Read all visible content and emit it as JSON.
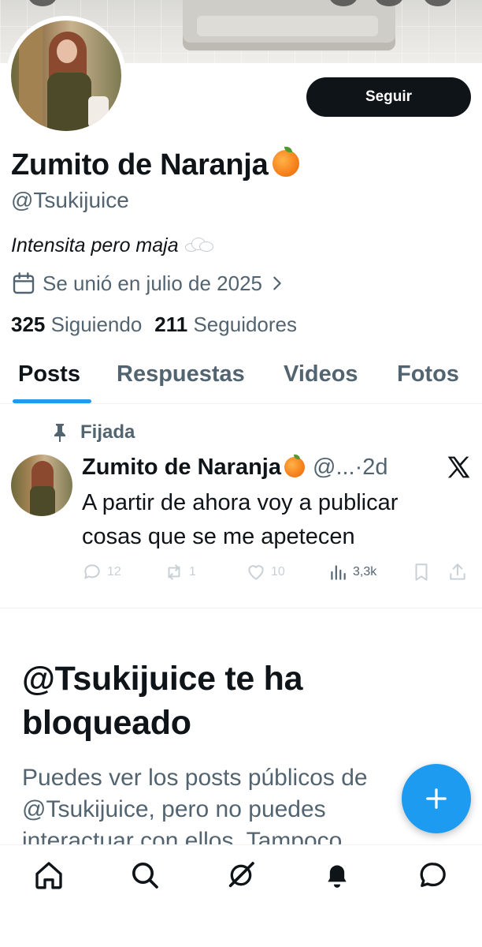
{
  "profile": {
    "display_name": "Zumito de Naranja",
    "name_emoji": "orange-emoji",
    "handle": "@Tsukijuice",
    "bio": "Intensita pero maja",
    "bio_emoji": "cloud-emoji",
    "joined": "Se unió en julio de 2025",
    "following_count": "325",
    "following_label": "Siguiendo",
    "followers_count": "211",
    "followers_label": "Seguidores",
    "follow_button": "Seguir"
  },
  "tabs": [
    {
      "label": "Posts",
      "active": true
    },
    {
      "label": "Respuestas",
      "active": false
    },
    {
      "label": "Videos",
      "active": false
    },
    {
      "label": "Fotos",
      "active": false
    }
  ],
  "post": {
    "pinned_label": "Fijada",
    "author": "Zumito de Naranja",
    "meta": "@...·2d",
    "text": "A partir de ahora voy a publicar cosas que se me apetecen",
    "replies": "12",
    "reposts": "1",
    "likes": "10",
    "views": "3,3k"
  },
  "blocked": {
    "title": "@Tsukijuice te ha bloqueado",
    "text": "Puedes ver los posts públicos de @Tsukijuice, pero no puedes interactuar con ellos. Tampoco"
  },
  "nav": {
    "items": [
      "home-icon",
      "search-icon",
      "grok-icon",
      "notifications-icon",
      "messages-icon"
    ]
  },
  "colors": {
    "accent": "#1d9bf0",
    "text": "#0f1419",
    "secondary": "#536471"
  }
}
